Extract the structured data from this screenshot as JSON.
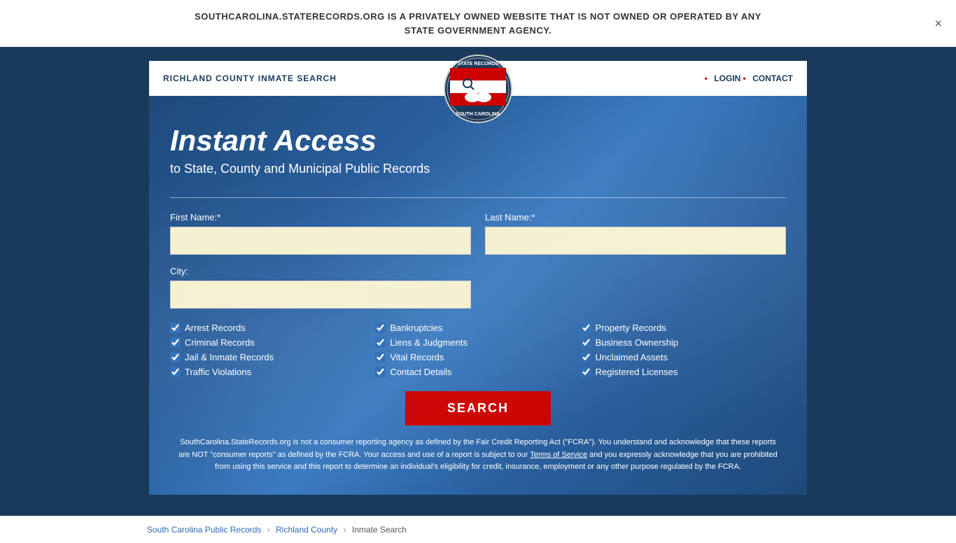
{
  "banner": {
    "text_line1": "SOUTHCAROLINA.STATERECORDS.ORG IS A PRIVATELY OWNED WEBSITE THAT IS NOT OWNED OR OPERATED BY ANY",
    "text_line2": "STATE GOVERNMENT AGENCY.",
    "close_label": "×"
  },
  "header": {
    "site_title": "RICHLAND COUNTY INMATE SEARCH",
    "nav": {
      "login_label": "LOGIN",
      "contact_label": "CONTACT",
      "bullet": "•"
    }
  },
  "hero": {
    "heading": "Instant Access",
    "subheading": "to State, County and Municipal Public Records",
    "form": {
      "first_name_label": "First Name:*",
      "last_name_label": "Last Name:*",
      "city_label": "City:",
      "first_name_placeholder": "",
      "last_name_placeholder": "",
      "city_placeholder": ""
    },
    "checkboxes": {
      "col1": [
        {
          "label": "Arrest Records",
          "checked": true
        },
        {
          "label": "Criminal Records",
          "checked": true
        },
        {
          "label": "Jail & Inmate Records",
          "checked": true
        },
        {
          "label": "Traffic Violations",
          "checked": true
        }
      ],
      "col2": [
        {
          "label": "Bankruptcies",
          "checked": true
        },
        {
          "label": "Liens & Judgments",
          "checked": true
        },
        {
          "label": "Vital Records",
          "checked": true
        },
        {
          "label": "Contact Details",
          "checked": true
        }
      ],
      "col3": [
        {
          "label": "Property Records",
          "checked": true
        },
        {
          "label": "Business Ownership",
          "checked": true
        },
        {
          "label": "Unclaimed Assets",
          "checked": true
        },
        {
          "label": "Registered Licenses",
          "checked": true
        }
      ]
    },
    "search_button": "SEARCH",
    "disclaimer": "SouthCarolina.StateRecords.org is not a consumer reporting agency as defined by the Fair Credit Reporting Act (\"FCRA\"). You understand and acknowledge that these reports are NOT \"consumer reports\" as defined by the FCRA. Your access and use of a report is subject to our Terms of Service and you expressly acknowledge that you are prohibited from using this service and this report to determine an individual's eligibility for credit, insurance, employment or any other purpose regulated by the FCRA.",
    "terms_link": "Terms of Service"
  },
  "breadcrumb": {
    "items": [
      {
        "label": "South Carolina Public Records",
        "href": "#"
      },
      {
        "label": "Richland County",
        "href": "#"
      },
      {
        "label": "Inmate Search",
        "href": null
      }
    ]
  }
}
